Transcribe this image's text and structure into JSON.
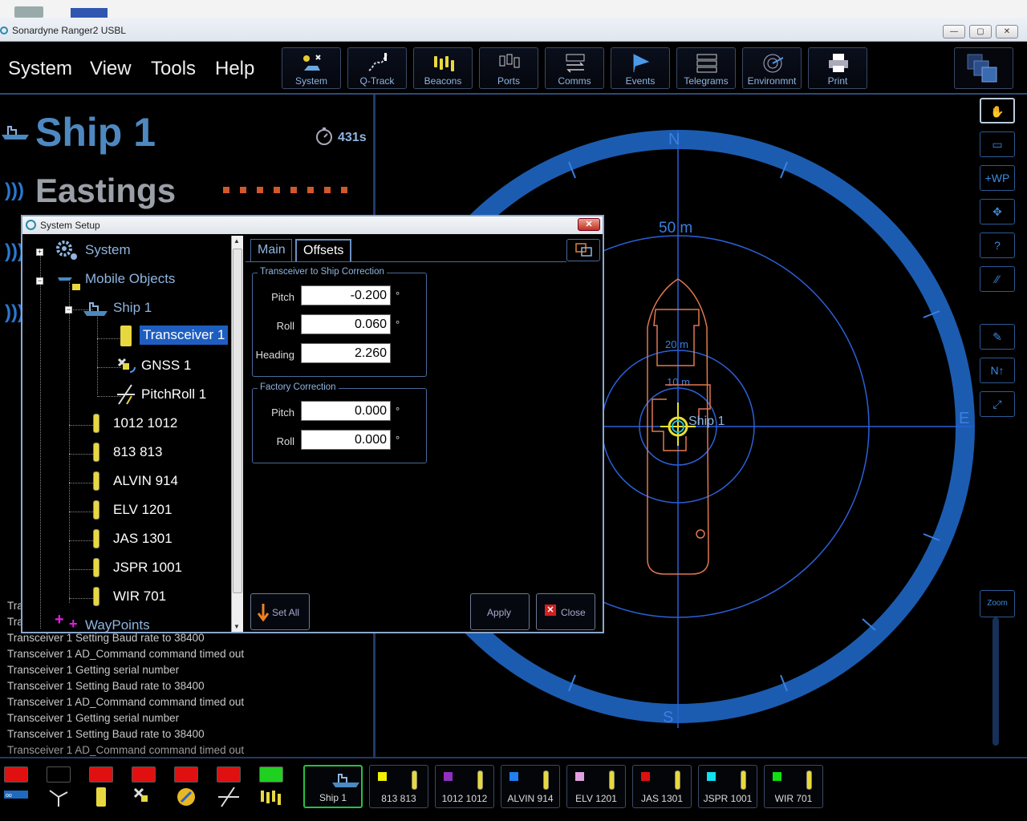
{
  "window": {
    "title": "Sonardyne Ranger2 USBL",
    "min": "—",
    "max": "▢",
    "close": "✕"
  },
  "menu": [
    "System",
    "View",
    "Tools",
    "Help"
  ],
  "toolbar": [
    "System",
    "Q-Track",
    "Beacons",
    "Ports",
    "Comms",
    "Events",
    "Telegrams",
    "Environmnt",
    "Print"
  ],
  "header": {
    "ship_name": "Ship 1",
    "timer": "431s",
    "field_label": "Eastings"
  },
  "log": [
    "Tra",
    "Tra",
    "Transceiver 1 Setting Baud rate to 38400",
    "Transceiver 1 AD_Command command timed out",
    "Transceiver 1 Getting serial number",
    "Transceiver 1 Setting Baud rate to 38400",
    "Transceiver 1 AD_Command command timed out",
    "Transceiver 1 Getting serial number",
    "Transceiver 1 Setting Baud rate to 38400",
    "Transceiver 1 AD_Command command timed out"
  ],
  "map": {
    "compass": {
      "n": "N",
      "s": "S",
      "e": "E"
    },
    "ranges": {
      "outer": "50 m",
      "mid": "20 m",
      "inner": "10 m"
    },
    "vessel_label": "Ship 1"
  },
  "right_tools": [
    "✋",
    "▭",
    "+WP",
    "✥",
    "?",
    "⁄⁄",
    "✎",
    "N↑",
    "⤢",
    "Zoom"
  ],
  "dialog": {
    "title": "System Setup",
    "close": "✕",
    "tree": {
      "system": "System",
      "mobile_objects": "Mobile Objects",
      "ship": "Ship 1",
      "transceiver": "Transceiver 1",
      "gnss": "GNSS 1",
      "pitchroll": "PitchRoll 1",
      "beacons": [
        "1012 1012",
        "813 813",
        "ALVIN 914",
        "ELV 1201",
        "JAS 1301",
        "JSPR 1001",
        "WIR 701"
      ],
      "waypoints": "WayPoints"
    },
    "tabs": [
      "Main",
      "Offsets"
    ],
    "transceiver_group": {
      "title": "Transceiver to Ship Correction",
      "pitch_label": "Pitch",
      "pitch": "-0.200",
      "roll_label": "Roll",
      "roll": "0.060",
      "heading_label": "Heading",
      "heading": "2.260"
    },
    "factory_group": {
      "title": "Factory Correction",
      "pitch_label": "Pitch",
      "pitch": "0.000",
      "roll_label": "Roll",
      "roll": "0.000"
    },
    "degree": "°",
    "buttons": {
      "set_all": "Set All",
      "apply": "Apply",
      "close": "Close"
    }
  },
  "status_leds": [
    "#e01010",
    "#000000",
    "#e01010",
    "#e01010",
    "#e01010",
    "#e01010",
    "#20d020"
  ],
  "objects": [
    {
      "label": "Ship 1",
      "color": ""
    },
    {
      "label": "813 813",
      "color": "#f0f000"
    },
    {
      "label": "1012 1012",
      "color": "#9030c0"
    },
    {
      "label": "ALVIN 914",
      "color": "#2080f0"
    },
    {
      "label": "ELV 1201",
      "color": "#e0a0e0"
    },
    {
      "label": "JAS 1301",
      "color": "#e01010"
    },
    {
      "label": "JSPR 1001",
      "color": "#10e0f0"
    },
    {
      "label": "WIR 701",
      "color": "#10e010"
    }
  ]
}
